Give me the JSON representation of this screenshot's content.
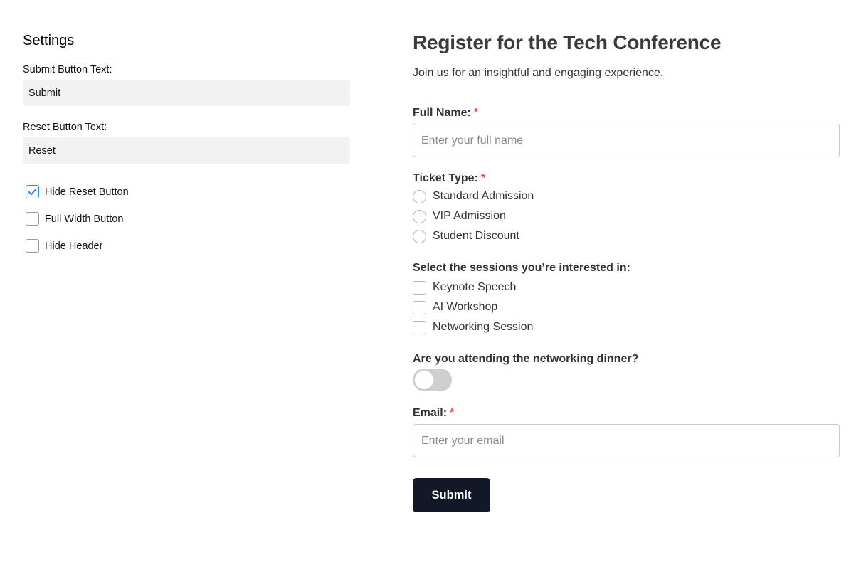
{
  "settings": {
    "title": "Settings",
    "submit_label": "Submit Button Text:",
    "submit_value": "Submit",
    "reset_label": "Reset Button Text:",
    "reset_value": "Reset",
    "options": [
      {
        "label": "Hide Reset Button",
        "checked": true
      },
      {
        "label": "Full Width Button",
        "checked": false
      },
      {
        "label": "Hide Header",
        "checked": false
      }
    ]
  },
  "form": {
    "title": "Register for the Tech Conference",
    "subtitle": "Join us for an insightful and engaging experience.",
    "full_name": {
      "label": "Full Name:",
      "required": "*",
      "placeholder": "Enter your full name"
    },
    "ticket": {
      "label": "Ticket Type:",
      "required": "*",
      "options": [
        "Standard Admission",
        "VIP Admission",
        "Student Discount"
      ]
    },
    "sessions": {
      "label": "Select the sessions you’re interested in:",
      "options": [
        "Keynote Speech",
        "AI Workshop",
        "Networking Session"
      ]
    },
    "dinner": {
      "label": "Are you attending the networking dinner?",
      "on": false
    },
    "email": {
      "label": "Email:",
      "required": "*",
      "placeholder": "Enter your email"
    },
    "submit_button": "Submit"
  },
  "colors": {
    "accent": "#3b82f6",
    "required": "#ef4444",
    "button_bg": "#111827",
    "toggle_off": "#cfcfcf"
  }
}
